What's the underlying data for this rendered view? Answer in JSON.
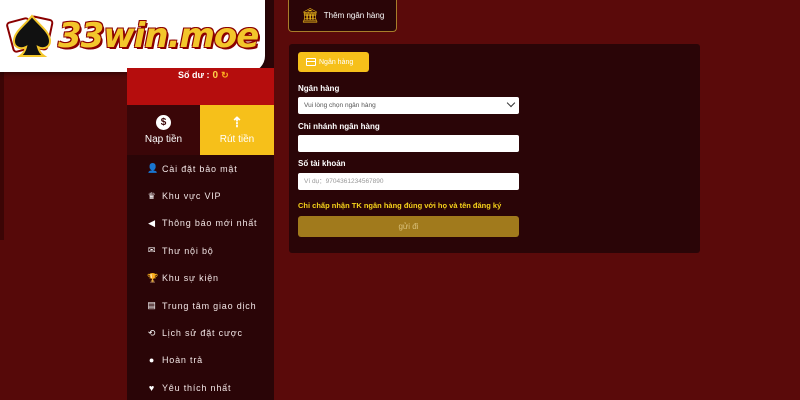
{
  "brand": {
    "logo_text": "33win.moe"
  },
  "balance": {
    "label": "Số dư :",
    "value": "0"
  },
  "tabs": [
    {
      "label": "Nạp tiền",
      "icon": "money-bag-icon"
    },
    {
      "label": "Rút tiền",
      "icon": "withdraw-hand-icon",
      "active": true
    }
  ],
  "menu": [
    {
      "label": "Cài đặt bảo mật",
      "icon": "user-gear-icon"
    },
    {
      "label": "Khu vực VIP",
      "icon": "crown-icon"
    },
    {
      "label": "Thông báo mới nhất",
      "icon": "megaphone-icon"
    },
    {
      "label": "Thư nội bộ",
      "icon": "envelope-icon"
    },
    {
      "label": "Khu sự kiện",
      "icon": "trophy-icon"
    },
    {
      "label": "Trung tâm giao dịch",
      "icon": "document-icon"
    },
    {
      "label": "Lịch sử đặt cược",
      "icon": "history-icon"
    },
    {
      "label": "Hoàn trả",
      "icon": "coin-icon"
    },
    {
      "label": "Yêu thích nhất",
      "icon": "heart-icon"
    }
  ],
  "top": {
    "add_bank_label": "Thêm ngân hàng"
  },
  "form": {
    "chip_label": "Ngân hàng",
    "bank_label": "Ngân hàng",
    "bank_placeholder": "Vui lòng chọn ngân hàng",
    "branch_label": "Chi nhánh ngân hàng",
    "branch_value": "",
    "account_label": "Số tài khoản",
    "account_placeholder": "Ví dụ：9704361234567890",
    "notice": "Chỉ chấp nhận TK ngân hàng đúng với họ và tên đăng ký",
    "submit_label": "gửi đi"
  },
  "colors": {
    "accent": "#f6c01a",
    "sidebar": "#2a0507",
    "background": "#5a0a0a",
    "balance_bar": "#b50d0d"
  }
}
